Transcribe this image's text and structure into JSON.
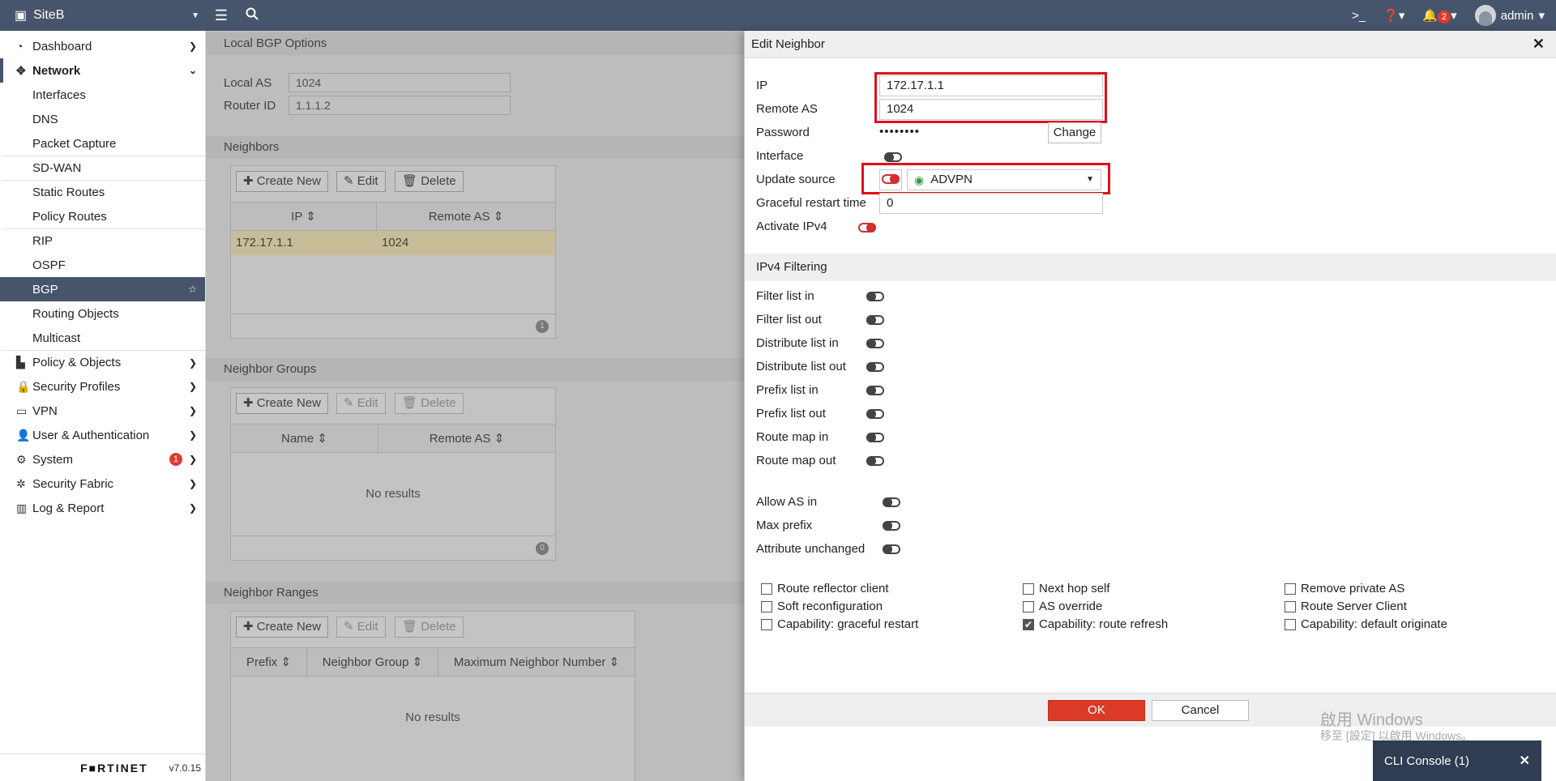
{
  "topbar": {
    "site_name": "SiteB",
    "notifications_count": "2",
    "user": "admin"
  },
  "sidebar": {
    "items": [
      {
        "label": "Dashboard"
      },
      {
        "label": "Network"
      },
      {
        "label": "Interfaces"
      },
      {
        "label": "DNS"
      },
      {
        "label": "Packet Capture"
      },
      {
        "label": "SD-WAN"
      },
      {
        "label": "Static Routes"
      },
      {
        "label": "Policy Routes"
      },
      {
        "label": "RIP"
      },
      {
        "label": "OSPF"
      },
      {
        "label": "BGP"
      },
      {
        "label": "Routing Objects"
      },
      {
        "label": "Multicast"
      },
      {
        "label": "Policy & Objects"
      },
      {
        "label": "Security Profiles"
      },
      {
        "label": "VPN"
      },
      {
        "label": "User & Authentication"
      },
      {
        "label": "System",
        "badge": "1"
      },
      {
        "label": "Security Fabric"
      },
      {
        "label": "Log & Report"
      }
    ],
    "brand": "F■RTINET",
    "version": "v7.0.15"
  },
  "main": {
    "local_bgp_title": "Local BGP Options",
    "local_as_label": "Local AS",
    "local_as_value": "1024",
    "router_id_label": "Router ID",
    "router_id_value": "1.1.1.2",
    "neighbors_title": "Neighbors",
    "create_new": "Create New",
    "edit": "Edit",
    "delete": "Delete",
    "neighbors_cols": [
      "IP",
      "Remote AS"
    ],
    "neighbor_row": {
      "ip": "172.17.1.1",
      "remote_as": "1024"
    },
    "neighbors_count": "1",
    "neighbor_groups_title": "Neighbor Groups",
    "neighbor_groups_cols": [
      "Name",
      "Remote AS"
    ],
    "no_results": "No results",
    "neighbor_groups_count": "0",
    "neighbor_ranges_title": "Neighbor Ranges",
    "neighbor_ranges_cols": [
      "Prefix",
      "Neighbor Group",
      "Maximum Neighbor Number"
    ]
  },
  "dialog": {
    "title": "Edit Neighbor",
    "ip_label": "IP",
    "ip_value": "172.17.1.1",
    "remote_as_label": "Remote AS",
    "remote_as_value": "1024",
    "password_label": "Password",
    "password_value": "••••••••",
    "change_label": "Change",
    "interface_label": "Interface",
    "update_source_label": "Update source",
    "update_source_value": "ADVPN",
    "graceful_label": "Graceful restart time",
    "graceful_value": "0",
    "activate_ipv4_label": "Activate IPv4",
    "ipv4_filtering_title": "IPv4 Filtering",
    "filters": [
      "Filter list in",
      "Filter list out",
      "Distribute list in",
      "Distribute list out",
      "Prefix list in",
      "Prefix list out",
      "Route map in",
      "Route map out"
    ],
    "allow_as_in": "Allow AS in",
    "max_prefix": "Max prefix",
    "attribute_unchanged": "Attribute unchanged",
    "checkboxes": [
      {
        "label": "Route reflector client",
        "checked": false
      },
      {
        "label": "Soft reconfiguration",
        "checked": false
      },
      {
        "label": "Capability: graceful restart",
        "checked": false
      },
      {
        "label": "Next hop self",
        "checked": false
      },
      {
        "label": "AS override",
        "checked": false
      },
      {
        "label": "Capability: route refresh",
        "checked": true
      },
      {
        "label": "Remove private AS",
        "checked": false
      },
      {
        "label": "Route Server Client",
        "checked": false
      },
      {
        "label": "Capability: default originate",
        "checked": false
      }
    ],
    "ok": "OK",
    "cancel": "Cancel"
  },
  "watermark": {
    "line1": "啟用 Windows",
    "line2": "移至 [設定] 以啟用 Windows。"
  },
  "cli_console": "CLI Console (1)",
  "colors": {
    "accent": "#46556b",
    "highlight": "#e0101c",
    "ok_button": "#da3a26"
  }
}
